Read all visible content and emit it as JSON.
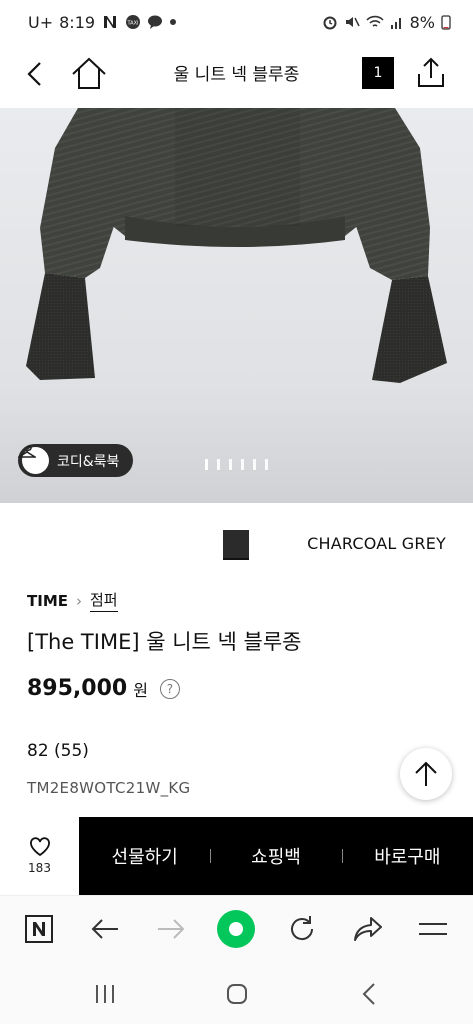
{
  "status_bar": {
    "carrier": "U+",
    "time": "8:19",
    "battery": "8%",
    "icons": [
      "nfc-icon",
      "notification-icon",
      "taxi-icon",
      "chat-icon",
      "alarm-icon",
      "mute-icon",
      "wifi-icon",
      "signal-icon",
      "battery-icon"
    ]
  },
  "header": {
    "title": "울 니트 넥 블루종",
    "cart_count": "1",
    "icons": {
      "back": "back-arrow-icon",
      "home": "home-icon",
      "share": "share-icon"
    }
  },
  "gallery": {
    "coordi_label": "코디&룩북",
    "page_dots": 6,
    "active_dot": 0
  },
  "color": {
    "name": "CHARCOAL GREY",
    "swatch_color": "#2b2b2b"
  },
  "product": {
    "brand": "TIME",
    "category": "점퍼",
    "name": "[The TIME] 울 니트 넥 블루종",
    "price": "895,000",
    "currency": "원",
    "size": "82 (55)",
    "code": "TM2E8WOTC21W_KG"
  },
  "purchase_bar": {
    "like_count": "183",
    "gift_label": "선물하기",
    "cart_label": "쇼핑백",
    "buy_label": "바로구매"
  },
  "browser_toolbar": {
    "icons": [
      "naver-n-icon",
      "back-icon",
      "forward-icon",
      "green-dot-icon",
      "reload-icon",
      "share-icon",
      "menu-icon"
    ]
  },
  "system_nav": {
    "icons": [
      "recents-icon",
      "home-icon",
      "back-icon"
    ]
  },
  "colors": {
    "accent_green": "#03c75a",
    "black": "#000000"
  }
}
